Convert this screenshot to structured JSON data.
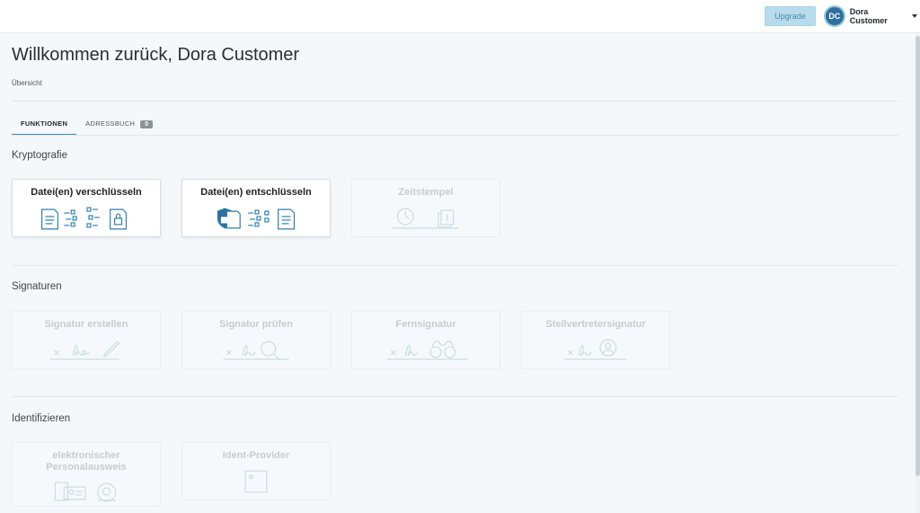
{
  "header": {
    "upgrade_label": "Upgrade",
    "user_initials": "DC",
    "user_name": "Dora Customer"
  },
  "page": {
    "title": "Willkommen zurück, Dora Customer",
    "breadcrumb": "Übersicht"
  },
  "tabs": [
    {
      "label": "FUNKTIONEN",
      "active": true
    },
    {
      "label": "ADRESSBUCH",
      "count": "0",
      "active": false
    }
  ],
  "sections": {
    "crypto": {
      "title": "Kryptografie",
      "cards": [
        {
          "label": "Datei(en) verschlüsseln",
          "enabled": true,
          "icon": "encrypt-file-icon"
        },
        {
          "label": "Datei(en) entschlüsseln",
          "enabled": true,
          "icon": "decrypt-file-icon"
        },
        {
          "label": "Zeitstempel",
          "enabled": false,
          "icon": "timestamp-icon"
        }
      ]
    },
    "signatures": {
      "title": "Signaturen",
      "cards": [
        {
          "label": "Signatur erstellen",
          "enabled": false,
          "icon": "signature-pen-icon"
        },
        {
          "label": "Signatur prüfen",
          "enabled": false,
          "icon": "signature-magnifier-icon"
        },
        {
          "label": "Fernsignatur",
          "enabled": false,
          "icon": "signature-binoculars-icon"
        },
        {
          "label": "Stellvertretersignatur",
          "enabled": false,
          "icon": "signature-person-icon"
        }
      ]
    },
    "identify": {
      "title": "Identifizieren",
      "cards": [
        {
          "label": "elektronischer Personalausweis",
          "enabled": false,
          "icon": "id-card-icon"
        },
        {
          "label": "Ident-Provider",
          "enabled": false,
          "icon": "ident-provider-icon"
        }
      ]
    }
  },
  "colors": {
    "accent": "#3b8fbf",
    "icon_active": "#2f7fb0",
    "icon_disabled": "#c9dbe6",
    "background": "#f4f8fa"
  }
}
